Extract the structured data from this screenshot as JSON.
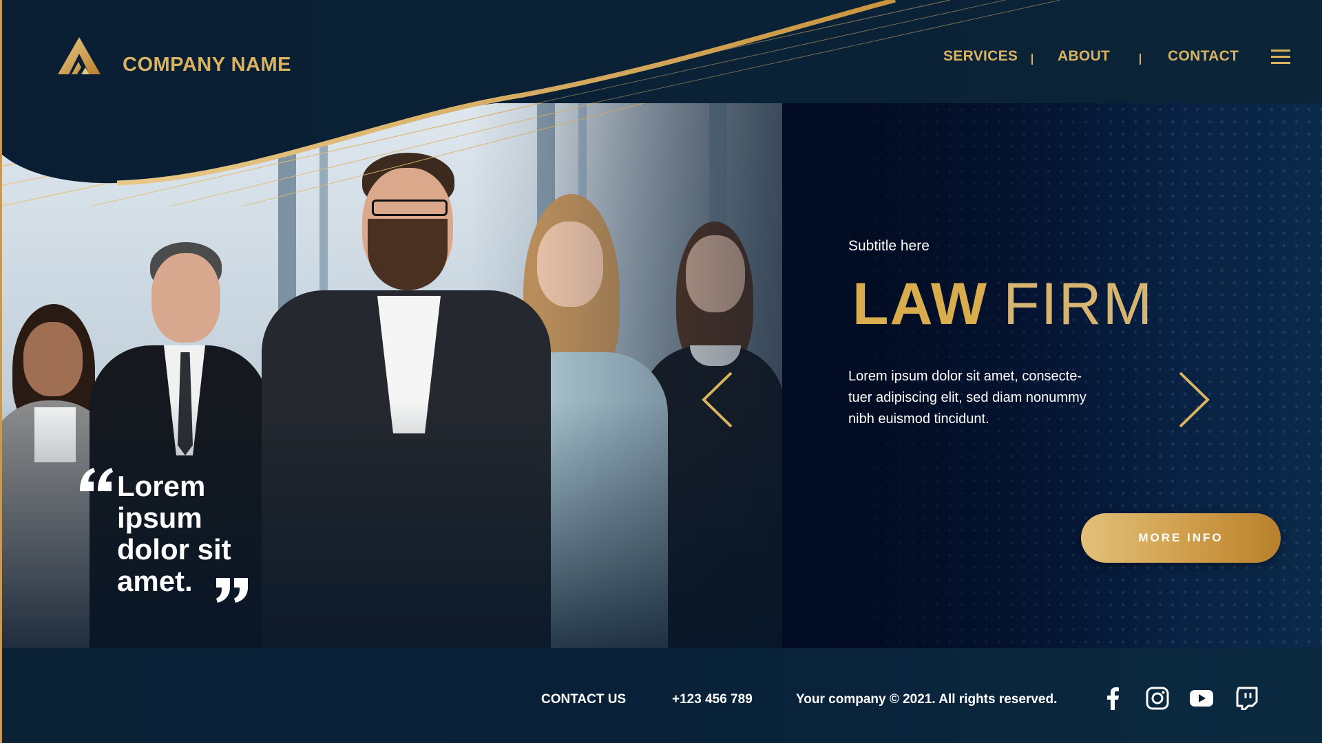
{
  "header": {
    "company_name": "COMPANY NAME",
    "logo_icon": "mountain-logo-icon",
    "nav": {
      "items": [
        "SERVICES",
        "ABOUT",
        "CONTACT"
      ],
      "separator": "|",
      "menu_icon": "hamburger-menu-icon"
    }
  },
  "hero": {
    "subtitle": "Subtitle here",
    "title_bold": "LAW",
    "title_light": "FIRM",
    "description": "Lorem ipsum dolor sit amet, consecte-tuer adipiscing elit, sed diam nonummy nibh euismod tincidunt.",
    "description_lines": [
      "Lorem ipsum dolor sit amet, consecte-",
      "tuer adipiscing elit, sed diam nonummy",
      "nibh euismod tincidunt."
    ],
    "prev_icon": "chevron-left-icon",
    "next_icon": "chevron-right-icon",
    "more_button": "MORE INFO"
  },
  "quote": {
    "lines": [
      "Lorem",
      "ipsum",
      "dolor sit",
      "amet."
    ],
    "open_icon": "quote-open-icon",
    "close_icon": "quote-close-icon"
  },
  "footer": {
    "contact_label": "CONTACT US",
    "phone": "+123 456 789",
    "copyright": "Your company © 2021. All rights reserved.",
    "social_icons": [
      "facebook-icon",
      "instagram-icon",
      "youtube-icon",
      "twitch-icon"
    ]
  },
  "colors": {
    "gold": "#d9b35f",
    "gold_dark": "#b9802c",
    "navy": "#061629",
    "white": "#ffffff"
  }
}
